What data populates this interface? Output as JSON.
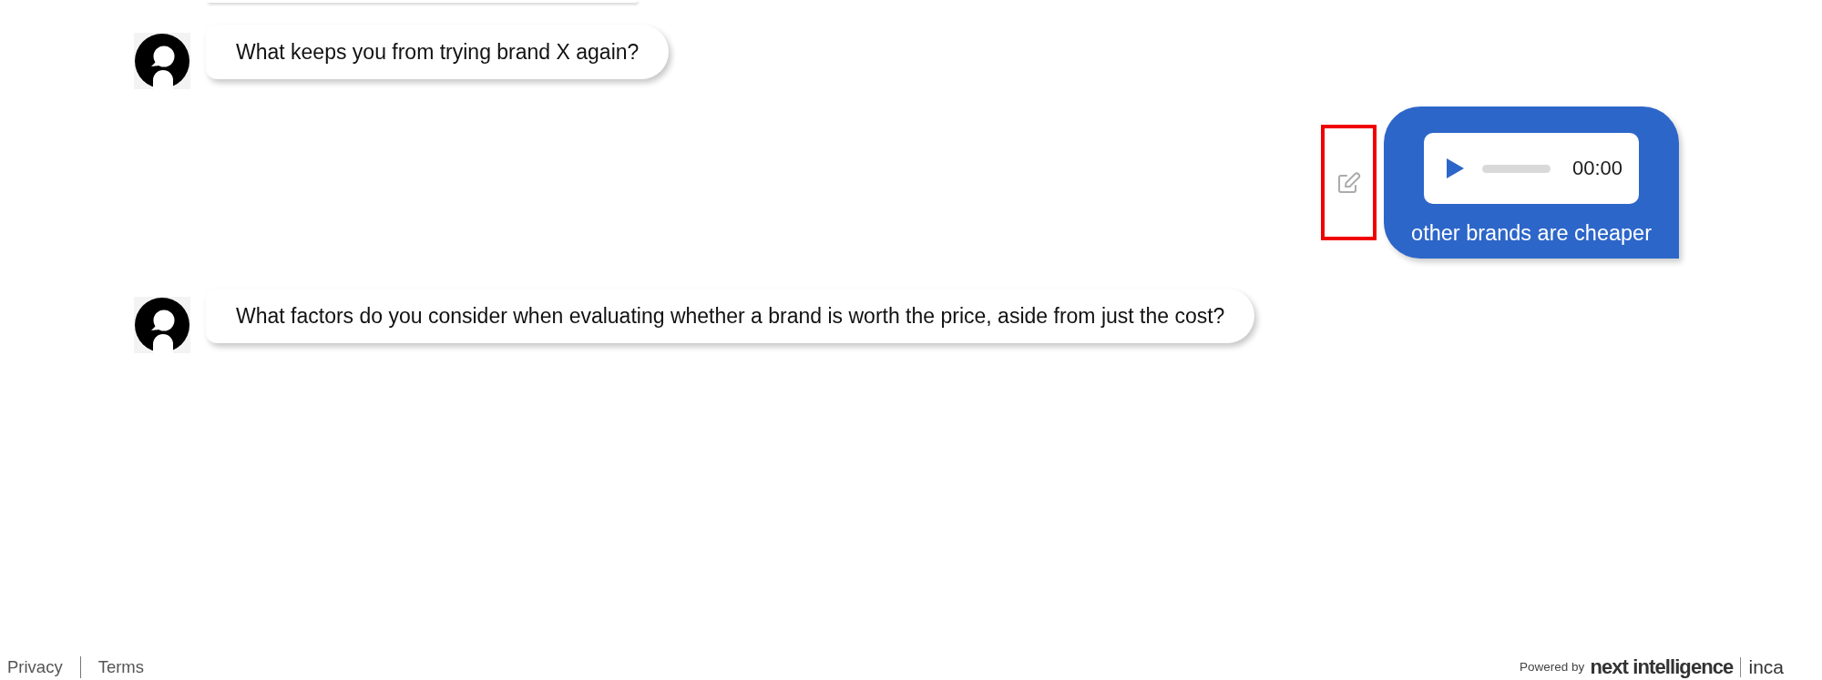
{
  "clipped_bubble_above": true,
  "messages": [
    {
      "kind": "question",
      "text": "What keeps you from trying brand X again?"
    },
    {
      "kind": "answer",
      "audio": {
        "time": "00:00"
      },
      "transcript": "other brands are cheaper",
      "edit": {
        "highlighted": true
      }
    },
    {
      "kind": "question",
      "text": "What factors do you consider when evaluating whether a brand is worth the price, aside from just the cost?"
    }
  ],
  "footer": {
    "links": [
      "Privacy",
      "Terms"
    ],
    "powered_by": "Powered by",
    "brand": "next intelligence",
    "partner": "inca"
  }
}
